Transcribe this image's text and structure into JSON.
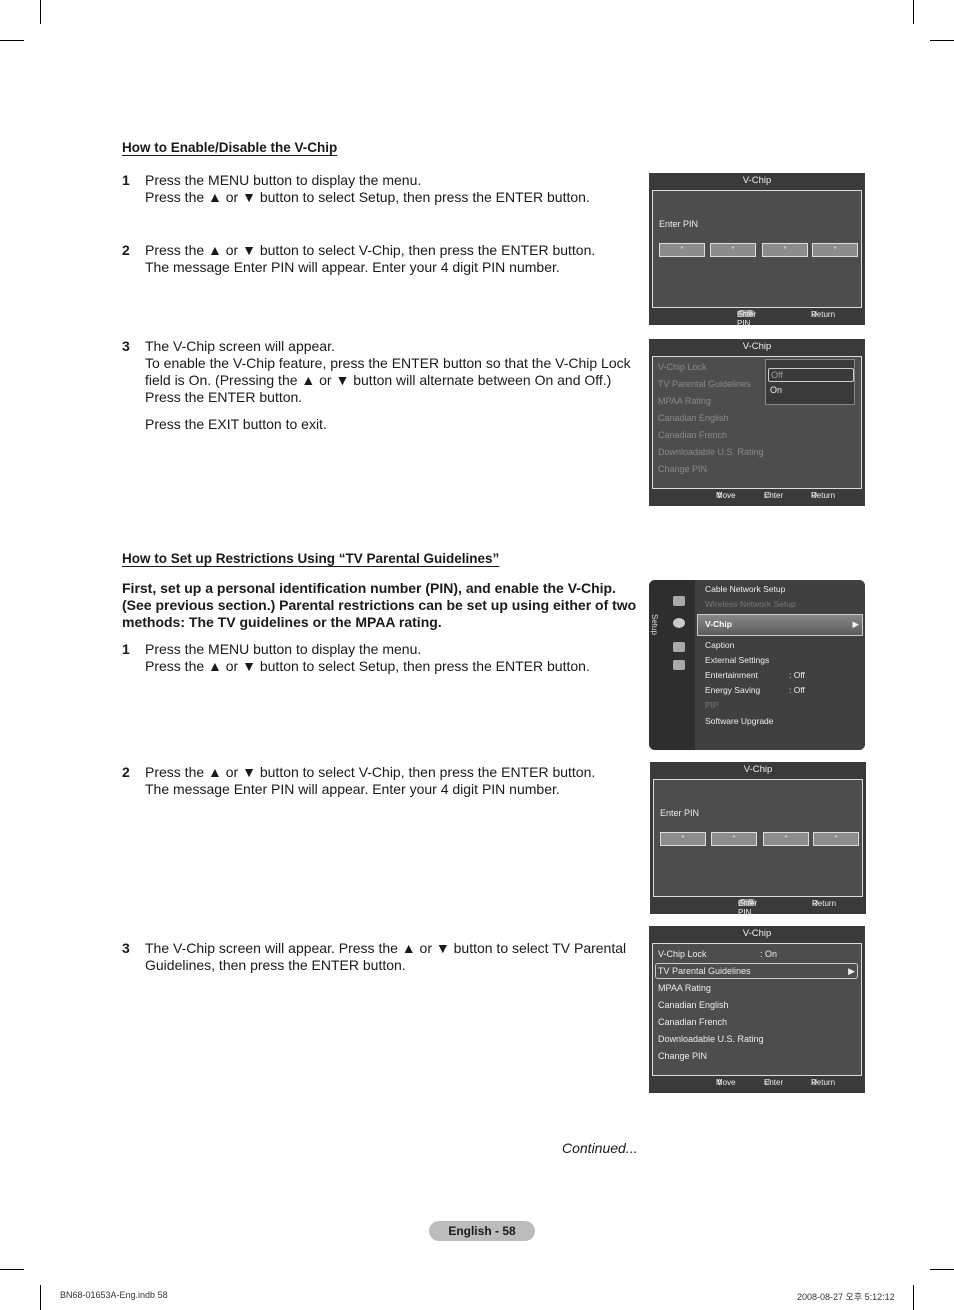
{
  "section1": {
    "heading": "How to Enable/Disable the V-Chip",
    "steps": [
      {
        "num": "1",
        "lines": [
          "Press the MENU button to display the menu.",
          "Press the ▲ or ▼ button to select Setup, then press the ENTER button."
        ]
      },
      {
        "num": "2",
        "lines": [
          "Press the ▲ or ▼ button to select V-Chip, then press the ENTER button.",
          "The message Enter PIN will appear. Enter your 4 digit PIN number."
        ]
      },
      {
        "num": "3",
        "lines": [
          "The V-Chip screen will appear.",
          "To enable the V-Chip feature, press the ENTER button so that the V-Chip Lock field is On. (Pressing the ▲ or ▼ button will alternate between On and Off.)",
          "Press the ENTER button.",
          "Press the EXIT button to exit."
        ]
      }
    ]
  },
  "section2": {
    "heading": "How to Set up Restrictions Using “TV Parental Guidelines”",
    "intro": "First, set up a personal identification number (PIN), and enable the V-Chip. (See previous section.) Parental restrictions can be set up using either of two methods: The TV guidelines or the MPAA rating.",
    "steps": [
      {
        "num": "1",
        "lines": [
          "Press the MENU button to display the menu.",
          "Press the ▲ or ▼ button to select Setup, then press the ENTER button."
        ]
      },
      {
        "num": "2",
        "lines": [
          "Press the ▲ or ▼ button to select V-Chip, then press the ENTER button.",
          "The message Enter PIN will appear. Enter your 4 digit PIN number."
        ]
      },
      {
        "num": "3",
        "lines": [
          "The V-Chip screen will appear. Press the ▲ or ▼ button to select TV Parental Guidelines, then press the ENTER button."
        ]
      }
    ]
  },
  "screens": {
    "pin": {
      "title": "V-Chip",
      "label": "Enter PIN",
      "mask": "*",
      "key_badge": "0~9",
      "key_label": "Enter PIN",
      "return_label": "Return"
    },
    "vchip_menu": {
      "title": "V-Chip",
      "items": [
        "V-Chip Lock",
        "TV Parental Guidelines",
        "MPAA Rating",
        "Canadian English",
        "Canadian French",
        "Downloadable U.S. Rating",
        "Change PIN"
      ],
      "lock_value": ": On",
      "popup_options": [
        "Off",
        "On"
      ],
      "move_label": "Move",
      "enter_label": "Enter",
      "return_label": "Return"
    },
    "setup": {
      "side_label": "Setup",
      "items": [
        {
          "label": "Cable Network Setup",
          "value": ""
        },
        {
          "label": "Wireless Network Setup",
          "value": ""
        },
        {
          "label": "V-Chip",
          "value": ""
        },
        {
          "label": "Caption",
          "value": ""
        },
        {
          "label": "External Settings",
          "value": ""
        },
        {
          "label": "Entertainment",
          "value": ": Off"
        },
        {
          "label": "Energy Saving",
          "value": ": Off"
        },
        {
          "label": "PIP",
          "value": ""
        },
        {
          "label": "Software Upgrade",
          "value": ""
        }
      ]
    }
  },
  "continued": "Continued...",
  "page_label": "English - 58",
  "footer": {
    "left": "BN68-01653A-Eng.indb   58",
    "right": "2008-08-27   오후 5:12:12"
  }
}
